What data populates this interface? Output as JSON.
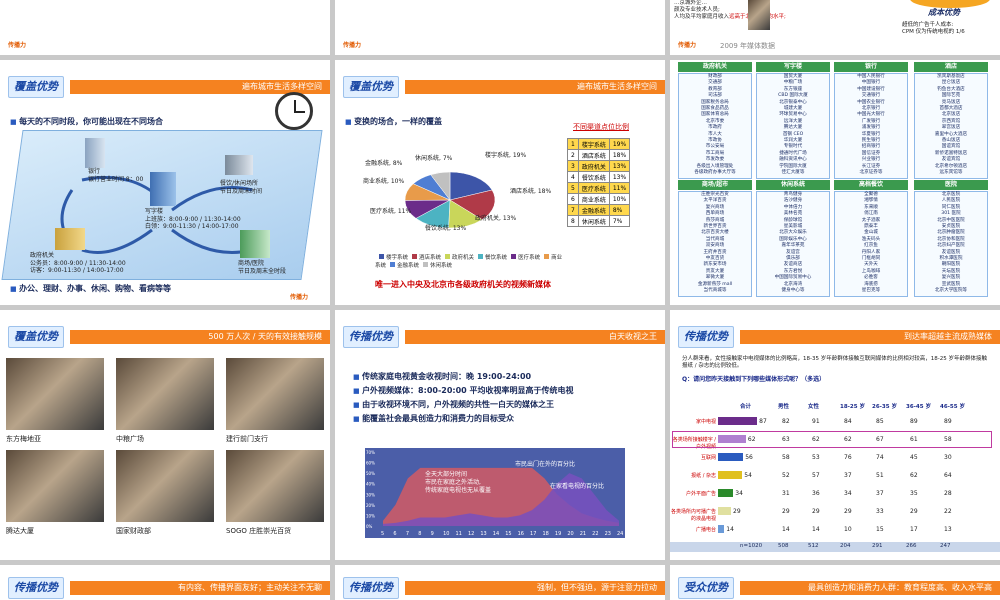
{
  "brand": {
    "logo_text": "传播力",
    "page_label": "2009 年媒体数据"
  },
  "r0": {
    "right_text_1": "…京城外企…",
    "right_text_2": "颜及专业技术人员;",
    "right_text_3": "人均及平均家庭月收入",
    "right_text_4": "远高于北京市平均水平;",
    "cost_title": "成本优势",
    "cost_desc_1": "超低的广告千人成本:",
    "cost_desc_2": "CPM 仅为传统电视的 1/6"
  },
  "s1": {
    "tag": "覆盖优势",
    "bar": "遍布城市生活多样空间",
    "bullet_1": "每天的不同时段，你可能出现在不同场合",
    "bullet_2": "办公、理财、办事、休闲、购物、看病等等",
    "nodes": [
      {
        "name": "银行",
        "time": "银行营业时间 8：00"
      },
      {
        "name": "写字楼",
        "time": "上班族：8:00-9:00 / 11:30-14:00"
      },
      {
        "name": "写字楼时间2",
        "time": "白领：9:00-11:30 / 14:00-17:00"
      },
      {
        "name": "餐饮/休闲场所",
        "time": "节日及周末时间"
      },
      {
        "name": "政府机关",
        "time": "公务员：8:00-9:00 / 11:30-14:00"
      },
      {
        "name": "办事时间",
        "time": "访客：9:00-11:30 / 14:00-17:00"
      },
      {
        "name": "商场/医院",
        "time": "节日及周末全时段"
      }
    ]
  },
  "s2": {
    "tag": "覆盖优势",
    "bar": "遍布城市生活多样空间",
    "bullet": "变换的场合，一样的覆盖",
    "table_title": "不同渠道点位比例",
    "rows": [
      {
        "rank": "1",
        "name": "楼宇系统",
        "pct": "19%",
        "hl": true
      },
      {
        "rank": "2",
        "name": "酒店系统",
        "pct": "18%",
        "hl": false
      },
      {
        "rank": "3",
        "name": "政府机关",
        "pct": "13%",
        "hl": true
      },
      {
        "rank": "4",
        "name": "餐饮系统",
        "pct": "13%",
        "hl": false
      },
      {
        "rank": "5",
        "name": "医疗系统",
        "pct": "11%",
        "hl": true
      },
      {
        "rank": "6",
        "name": "商业系统",
        "pct": "10%",
        "hl": false
      },
      {
        "rank": "7",
        "name": "金融系统",
        "pct": "8%",
        "hl": true
      },
      {
        "rank": "8",
        "name": "休闲系统",
        "pct": "7%",
        "hl": false
      }
    ],
    "pie_labels": [
      "楼宇系统, 19%",
      "酒店系统, 18%",
      "政府机关, 13%",
      "餐饮系统, 13%",
      "医疗系统, 11%",
      "商业系统, 10%",
      "金融系统, 8%",
      "休闲系统, 7%"
    ],
    "legend": [
      "楼宇系统",
      "酒店系统",
      "政府机关",
      "餐饮系统",
      "医疗系统",
      "商业系统",
      "金融系统",
      "休闲系统"
    ],
    "legend_colors": [
      "#3d55a8",
      "#b03a48",
      "#c9d65a",
      "#4cb3c2",
      "#6b2c8a",
      "#e89b4a",
      "#4f7ed3",
      "#c0c0c0"
    ],
    "bottom_red": "唯一进入中央及北京市各级政府机关的视频新媒体"
  },
  "s3": {
    "cats": [
      {
        "name": "政府机关",
        "items": [
          "财政部",
          "交通部",
          "教育部",
          "司法部",
          "国家税务总局",
          "国家食品药品",
          "国家体育总局",
          "北京市委",
          "市政府",
          "市人大",
          "市政协",
          "市公安局",
          "市工商局",
          "市发改委",
          "各级出入境管理处",
          "各级政府办事大厅等"
        ]
      },
      {
        "name": "写字楼",
        "items": [
          "国贸大厦",
          "中粮广场",
          "东方银座",
          "CBD 国际大厦",
          "北京银泰中心",
          "城建大厦",
          "环球贸易中心",
          "远洋大厦",
          "腾达大厦",
          "首钢 CEO",
          "华润大厦",
          "专银时代",
          "捷通时代广场",
          "融科资讯中心",
          "学院国际大厦",
          "佳汇大厦等"
        ]
      },
      {
        "name": "银行",
        "items": [
          "中国人民银行",
          "中国银行",
          "中国建设银行",
          "交通银行",
          "中国农业银行",
          "北京银行",
          "中国光大银行",
          "广发银行",
          "浦发银行",
          "华夏银行",
          "民生银行",
          "招商银行",
          "国信证券",
          "兴业银行",
          "长江证券",
          "北京证券等"
        ]
      },
      {
        "name": "酒店",
        "items": [
          "凯宾斯基饭店",
          "昆仑饭店",
          "钓鱼台大酒店",
          "国际艺苑",
          "亮马饭店",
          "首都大酒店",
          "北京饭店",
          "京西宾馆",
          "翠宫饭店",
          "嘉里中心大酒店",
          "香山饭店",
          "国谊宾馆",
          "新侨诺富特饭店",
          "友谊宾馆",
          "北京希尔顿酒店",
          "远东宾馆等"
        ]
      },
      {
        "name": "商场/超市",
        "items": [
          "庄胜崇光百货",
          "太平洋百货",
          "复兴商场",
          "西单商场",
          "燕莎商城",
          "新世界百货",
          "北京百货大楼",
          "当代商城",
          "双安商场",
          "王府井百货",
          "中友百货",
          "新东安市场",
          "贵友大厦",
          "翠微大厦",
          "金源新燕莎 mall",
          "当代商城等"
        ]
      },
      {
        "name": "休闲系统",
        "items": [
          "青鸟健身",
          "浩沙健身",
          "中体倍力",
          "美林名苑",
          "保龄球馆",
          "星美影城",
          "北京大众娱乐",
          "国际娱乐中心",
          "嘉年华茶苑",
          "友谊宫",
          "俱乐部",
          "友谊商店",
          "东方君悦",
          "中国国际贸易中心",
          "北京海湾",
          "健身中心等"
        ]
      },
      {
        "name": "高档餐饮",
        "items": [
          "全聚德",
          "湘鄂情",
          "东来顺",
          "俏江南",
          "太子酒家",
          "鼎泰丰",
          "金山城",
          "渔夫码头",
          "红京鱼",
          "丹阳人家",
          "门框胡同",
          "天外天",
          "上岛咖啡",
          "必胜客",
          "海底捞",
          "星巴克等"
        ]
      },
      {
        "name": "医院",
        "items": [
          "北京医院",
          "人民医院",
          "同仁医院",
          "301 医院",
          "北京中医医院",
          "安贞医院",
          "北京肿瘤医院",
          "北京协和医院",
          "北京妇产医院",
          "友谊医院",
          "积水潭医院",
          "朝阳医院",
          "天坛医院",
          "复兴医院",
          "宣武医院",
          "北京大学医院等"
        ]
      }
    ]
  },
  "s4": {
    "tag": "覆盖优势",
    "bar": "500 万人次 / 天的有效接触规模",
    "photos": [
      "东方梅地亚",
      "中粮广场",
      "建行前门支行",
      "腾达大厦",
      "国家财政部",
      "SOGO 庄胜崇光百货"
    ]
  },
  "s5": {
    "tag": "传播优势",
    "bar": "白天收视之王",
    "bullets": [
      "传统家庭电视黄金收视时间：晚 19:00-24:00",
      "户外视频媒体：8:00-20:00 平均收视率明显高于传统电视",
      "由于收视环境不同，户外视频的共性一白天的媒体之王",
      "能覆盖社会最具创造力和消费力的目标受众"
    ],
    "chart_data": {
      "type": "area",
      "x": [
        5,
        6,
        7,
        8,
        9,
        10,
        11,
        12,
        13,
        14,
        15,
        16,
        17,
        18,
        19,
        20,
        21,
        22,
        23,
        24
      ],
      "ylim": [
        0,
        70
      ],
      "yticks": [
        "70%",
        "60%",
        "50%",
        "40%",
        "30%",
        "20%",
        "10%",
        "0%"
      ],
      "series": [
        {
          "name": "市民出门在外的百分比",
          "values": [
            5,
            20,
            45,
            55,
            55,
            55,
            55,
            55,
            55,
            55,
            55,
            55,
            55,
            45,
            30,
            20,
            12,
            8,
            5,
            3
          ]
        },
        {
          "name": "在家看电视的百分比",
          "values": [
            2,
            3,
            5,
            8,
            8,
            8,
            10,
            12,
            10,
            8,
            8,
            10,
            15,
            25,
            40,
            50,
            45,
            30,
            15,
            5
          ]
        }
      ],
      "annotation": "全天大部分时间\n市民在家庭之外活动,\n传统家庭电视也无从覆盖"
    }
  },
  "s6": {
    "tag": "传播优势",
    "bar": "到达率超越主流成熟媒体",
    "intro": "分人群来看，女性接触家中电视媒体的比例略高，18-35 岁年龄群体接触互联网媒体的比例相对较高，18-25 岁年龄群体接触报纸 / 杂志的比例较低。",
    "question": "Q：请问您昨天接触到下列哪些媒体形式呢？（多选）",
    "cols": [
      "合计",
      "男性",
      "女性",
      "18-25 岁",
      "26-35 岁",
      "36-45 岁",
      "46-55 岁"
    ],
    "rows": [
      {
        "label": "家中电视",
        "total": 87,
        "vals": [
          "82",
          "91",
          "84",
          "85",
          "89",
          "89"
        ],
        "color": "#6b2c8a"
      },
      {
        "label": "各类场所接触楼宇 / 户外视频",
        "total": 62,
        "vals": [
          "63",
          "62",
          "62",
          "67",
          "61",
          "58"
        ],
        "color": "#b080d0"
      },
      {
        "label": "互联网",
        "total": 56,
        "vals": [
          "58",
          "53",
          "76",
          "74",
          "45",
          "30"
        ],
        "color": "#2a5bbf"
      },
      {
        "label": "报纸 / 杂志",
        "total": 54,
        "vals": [
          "52",
          "57",
          "37",
          "51",
          "62",
          "64"
        ],
        "color": "#e0c020"
      },
      {
        "label": "户外平面广告",
        "total": 34,
        "vals": [
          "31",
          "36",
          "34",
          "37",
          "35",
          "28"
        ],
        "color": "#2b8a2b"
      },
      {
        "label": "各类场所内可播广告的液晶电视",
        "total": 29,
        "vals": [
          "29",
          "29",
          "29",
          "33",
          "29",
          "22"
        ],
        "color": "#e0e0a0"
      },
      {
        "label": "广播电台",
        "total": 14,
        "vals": [
          "14",
          "14",
          "10",
          "15",
          "17",
          "13"
        ],
        "color": "#6a9ad8"
      }
    ],
    "footer": [
      "n=1020",
      "508",
      "512",
      "204",
      "291",
      "266",
      "247"
    ]
  },
  "r3": {
    "s1": {
      "tag": "传播优势",
      "bar": "有内容、传播界面友好；主动关注不无聊"
    },
    "s2": {
      "tag": "传播优势",
      "bar": "强制，但不强迫，源于注意力拉动"
    },
    "s3": {
      "tag": "受众优势",
      "bar": "最具创造力和消费力人群：教育程度高、收入水平高"
    }
  }
}
